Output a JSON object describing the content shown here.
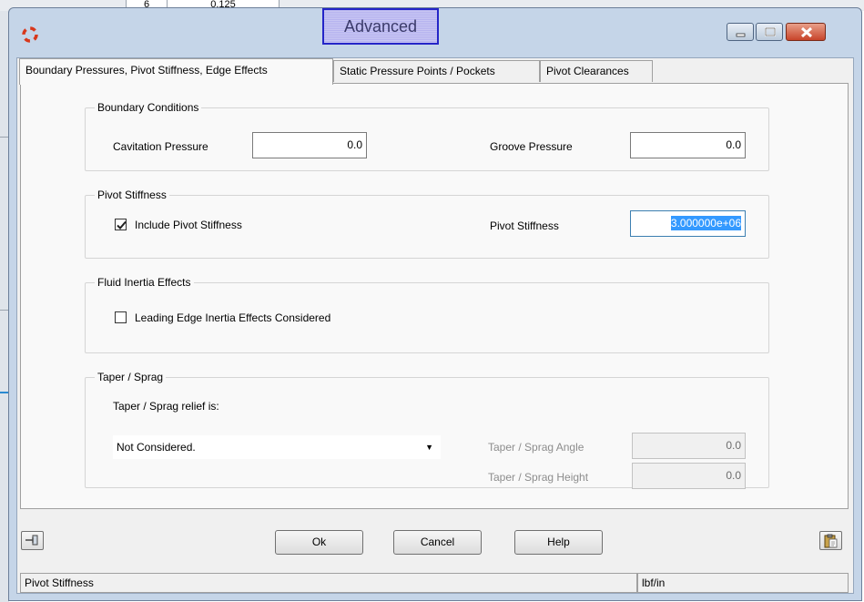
{
  "background": {
    "cells": [
      "6",
      "0.125"
    ]
  },
  "window": {
    "title": "Advanced",
    "colors": {
      "frame": "#c5d5e8",
      "title_highlight": "#b6b3ef",
      "close": "#c8442a",
      "selection": "#3399ff"
    }
  },
  "tabs": [
    {
      "label": "Boundary Pressures, Pivot Stiffness, Edge Effects",
      "active": true
    },
    {
      "label": "Static Pressure Points / Pockets",
      "active": false
    },
    {
      "label": "Pivot Clearances",
      "active": false
    }
  ],
  "boundary": {
    "title": "Boundary Conditions",
    "cavitation_label": "Cavitation Pressure",
    "cavitation_value": "0.0",
    "groove_label": "Groove Pressure",
    "groove_value": "0.0"
  },
  "pivot": {
    "title": "Pivot Stiffness",
    "include_label": "Include Pivot Stiffness",
    "include_checked": true,
    "stiffness_label": "Pivot Stiffness",
    "stiffness_value": "3.000000e+06"
  },
  "fluid": {
    "title": "Fluid Inertia Effects",
    "leading_edge_label": "Leading Edge Inertia Effects Considered",
    "leading_edge_checked": false
  },
  "taper": {
    "title": "Taper / Sprag",
    "relief_label": "Taper / Sprag relief is:",
    "relief_selected": "Not Considered.",
    "angle_label": "Taper / Sprag Angle",
    "angle_value": "0.0",
    "height_label": "Taper / Sprag Height",
    "height_value": "0.0"
  },
  "buttons": {
    "ok": "Ok",
    "cancel": "Cancel",
    "help": "Help"
  },
  "status": {
    "message": "Pivot Stiffness",
    "units": "lbf/in"
  }
}
